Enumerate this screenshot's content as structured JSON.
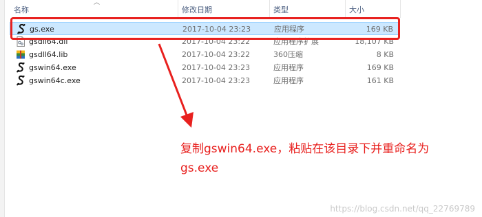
{
  "header": {
    "name": "名称",
    "date_modified": "修改日期",
    "type": "类型",
    "size": "大小"
  },
  "files": [
    {
      "name": "gs.exe",
      "date": "2017-10-04 23:23",
      "type": "应用程序",
      "size": "169 KB",
      "icon": "ghostscript-app-icon",
      "selected": true
    },
    {
      "name": "gsdll64.dll",
      "date": "2017-10-04 23:22",
      "type": "应用程序扩展",
      "size": "18,107 KB",
      "icon": "dll-file-icon",
      "selected": false
    },
    {
      "name": "gsdll64.lib",
      "date": "2017-10-04 23:22",
      "type": "360压缩",
      "size": "8 KB",
      "icon": "archive-file-icon",
      "selected": false
    },
    {
      "name": "gswin64.exe",
      "date": "2017-10-04 23:23",
      "type": "应用程序",
      "size": "169 KB",
      "icon": "ghostscript-app-icon",
      "selected": false
    },
    {
      "name": "gswin64c.exe",
      "date": "2017-10-04 23:23",
      "type": "应用程序",
      "size": "161 KB",
      "icon": "ghostscript-app-icon",
      "selected": false
    }
  ],
  "annotation": {
    "line1": "复制gswin64.exe，粘贴在该目录下并重命名为",
    "line2": "gs.exe"
  },
  "watermark": "https://blog.csdn.net/qq_22769789",
  "colors": {
    "highlight": "#e8201e",
    "selection_bg": "#cce8ff",
    "header_text": "#4d6082"
  }
}
